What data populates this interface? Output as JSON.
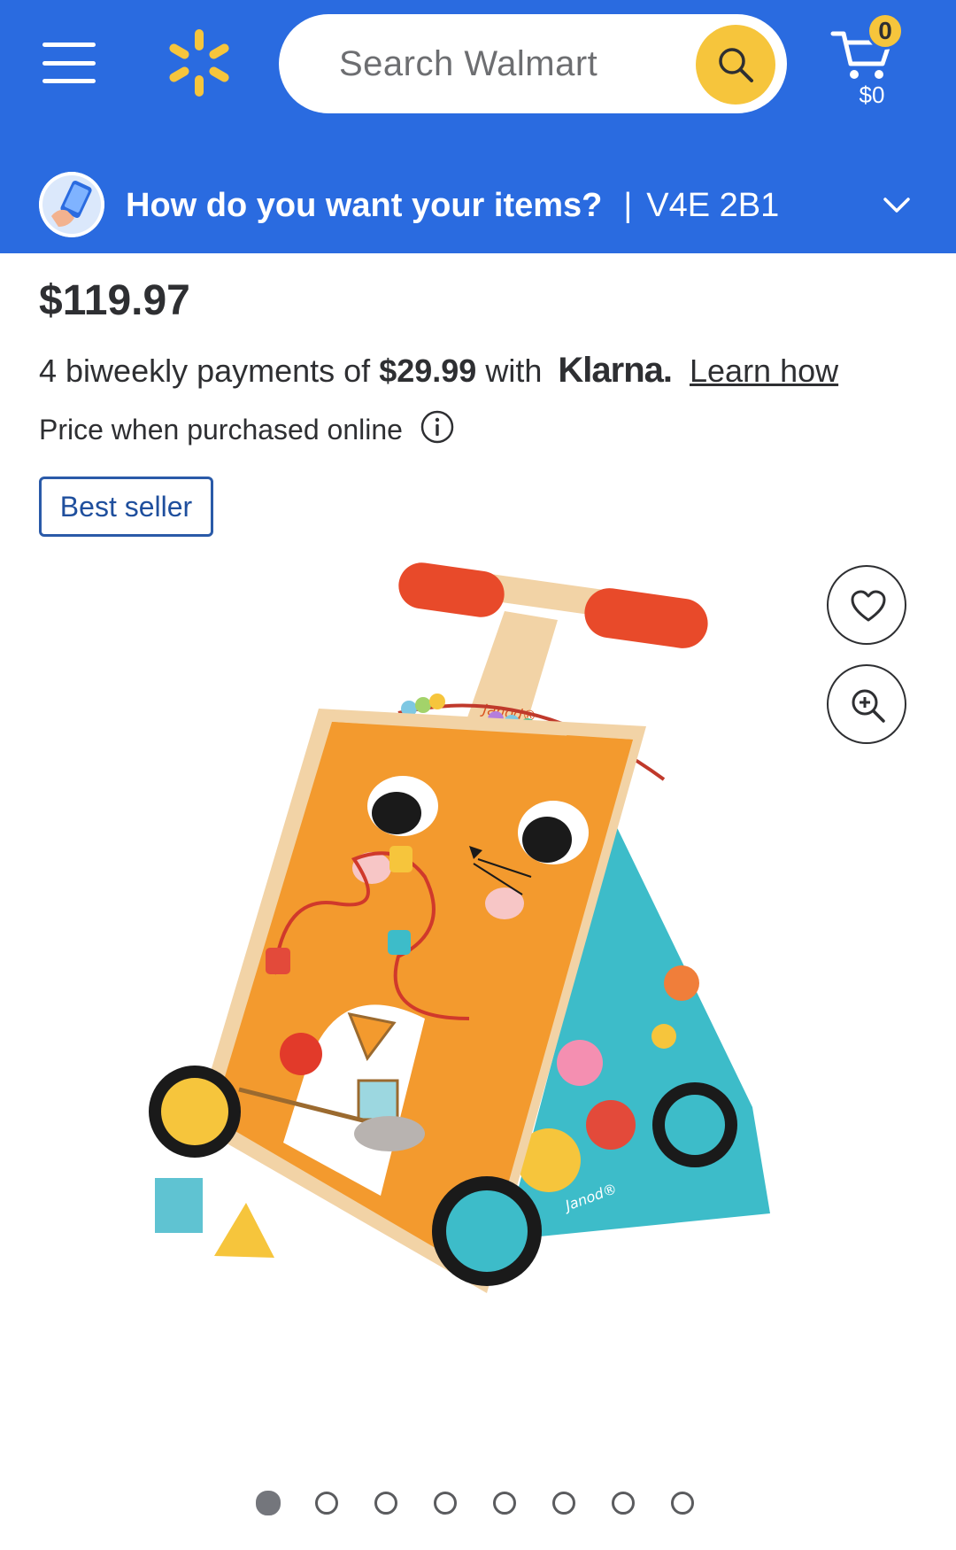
{
  "header": {
    "menu_icon": "hamburger-menu-icon",
    "logo_icon": "walmart-spark-icon",
    "search": {
      "placeholder": "Search Walmart",
      "button_icon": "search-icon"
    },
    "cart": {
      "icon": "cart-icon",
      "count": "0",
      "total": "$0"
    }
  },
  "fulfillment": {
    "icon": "phone-hand-icon",
    "question": "How do you want your items?",
    "separator": "|",
    "postal_code": "V4E 2B1",
    "chevron_icon": "chevron-down-icon"
  },
  "price": {
    "amount": "$119.97",
    "klarna": {
      "prefix": "4 biweekly payments of",
      "installment": "$29.99",
      "with": "with",
      "brand": "Klarna.",
      "link": "Learn how"
    },
    "note": "Price when purchased online",
    "info_icon": "info-icon"
  },
  "badge": {
    "label": "Best seller"
  },
  "product_image": {
    "description_icon": "cat-activity-walker-image",
    "brand_marks": [
      "Janod®",
      "Janod®"
    ]
  },
  "actions": {
    "favorite_icon": "heart-icon",
    "zoom_icon": "zoom-in-icon"
  },
  "carousel": {
    "total": 8,
    "active_index": 0
  },
  "colors": {
    "brand_blue": "#2a6be0",
    "spark_yellow": "#f6c53c",
    "badge_blue": "#1f4f9d",
    "text": "#2e2f32"
  }
}
